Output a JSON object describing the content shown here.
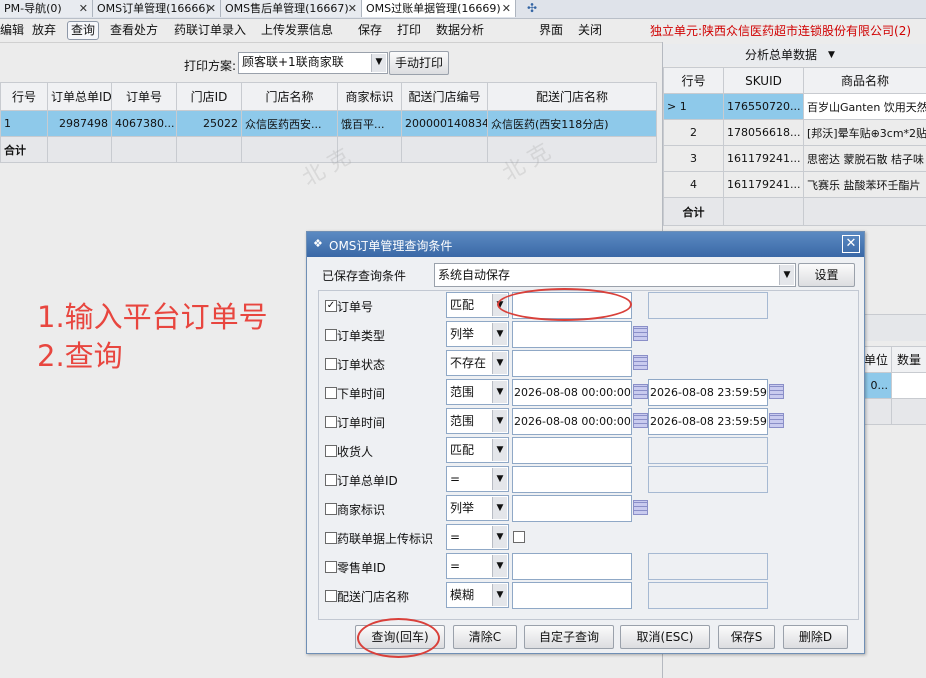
{
  "tabs": [
    {
      "label": "PM-导航(0)"
    },
    {
      "label": "OMS订单管理(16666)"
    },
    {
      "label": "OMS售后单管理(16667)"
    },
    {
      "label": "OMS过账单据管理(16669)"
    }
  ],
  "toolbar": {
    "items": [
      "编辑",
      "放弃",
      "查询",
      "查看处方",
      "药联订单录入",
      "上传发票信息",
      "保存",
      "打印",
      "数据分析",
      "界面",
      "关闭"
    ],
    "unit": "独立单元:陕西众信医药超市连锁股份有限公司(2)"
  },
  "print": {
    "label": "打印方案:",
    "scheme": "顾客联+1联商家联",
    "button": "手动打印"
  },
  "main_grid": {
    "headers": [
      "行号",
      "订单总单ID",
      "订单号",
      "门店ID",
      "门店名称",
      "商家标识",
      "配送门店编号",
      "配送门店名称"
    ],
    "rows": [
      [
        "1",
        "2987498",
        "4067380...",
        "25022",
        "众信医药西安...",
        "饿百平...",
        "200000140834",
        "众信医药(西安118分店)"
      ]
    ],
    "total_label": "合计"
  },
  "right_panel": {
    "title": "分析总单数据",
    "headers": [
      "行号",
      "SKUID",
      "商品名称"
    ],
    "rows": [
      [
        "1",
        "176550720...",
        "百岁山Ganten 饮用天然"
      ],
      [
        "2",
        "178056618...",
        "[邦沃]晕车贴⊕3cm*2贴"
      ],
      [
        "3",
        "161179241...",
        "思密达 蒙脱石散 桔子味"
      ],
      [
        "4",
        "161179241...",
        "飞赛乐 盐酸苯环壬酯片"
      ]
    ],
    "total_label": "合计",
    "lower_headers": [
      "单位",
      "数量"
    ],
    "lower_cell": "0..."
  },
  "annotation": {
    "line1": "1.输入平台订单号",
    "line2": "2.查询"
  },
  "dialog": {
    "title": "OMS订单管理查询条件",
    "saved_label": "已保存查询条件",
    "saved_value": "系统自动保存",
    "settings_button": "设置",
    "conditions": [
      {
        "label": "订单号",
        "checked": true,
        "op": "匹配",
        "v1": "",
        "v2": ""
      },
      {
        "label": "订单类型",
        "checked": false,
        "op": "列举",
        "v1": ""
      },
      {
        "label": "订单状态",
        "checked": false,
        "op": "不存在",
        "v1": ""
      },
      {
        "label": "下单时间",
        "checked": false,
        "op": "范围",
        "v1": "2026-08-08 00:00:00",
        "v2": "2026-08-08 23:59:59"
      },
      {
        "label": "订单时间",
        "checked": false,
        "op": "范围",
        "v1": "2026-08-08 00:00:00",
        "v2": "2026-08-08 23:59:59"
      },
      {
        "label": "收货人",
        "checked": false,
        "op": "匹配",
        "v1": "",
        "v2": ""
      },
      {
        "label": "订单总单ID",
        "checked": false,
        "op": "=",
        "v1": "",
        "v2": ""
      },
      {
        "label": "商家标识",
        "checked": false,
        "op": "列举",
        "v1": ""
      },
      {
        "label": "药联单据上传标识",
        "checked": false,
        "op": "="
      },
      {
        "label": "零售单ID",
        "checked": false,
        "op": "=",
        "v1": "",
        "v2": ""
      },
      {
        "label": "配送门店名称",
        "checked": false,
        "op": "模糊",
        "v1": "",
        "v2": ""
      }
    ],
    "buttons": [
      "查询(回车)",
      "清除C",
      "自定子查询",
      "取消(ESC)",
      "保存S",
      "删除D"
    ]
  }
}
